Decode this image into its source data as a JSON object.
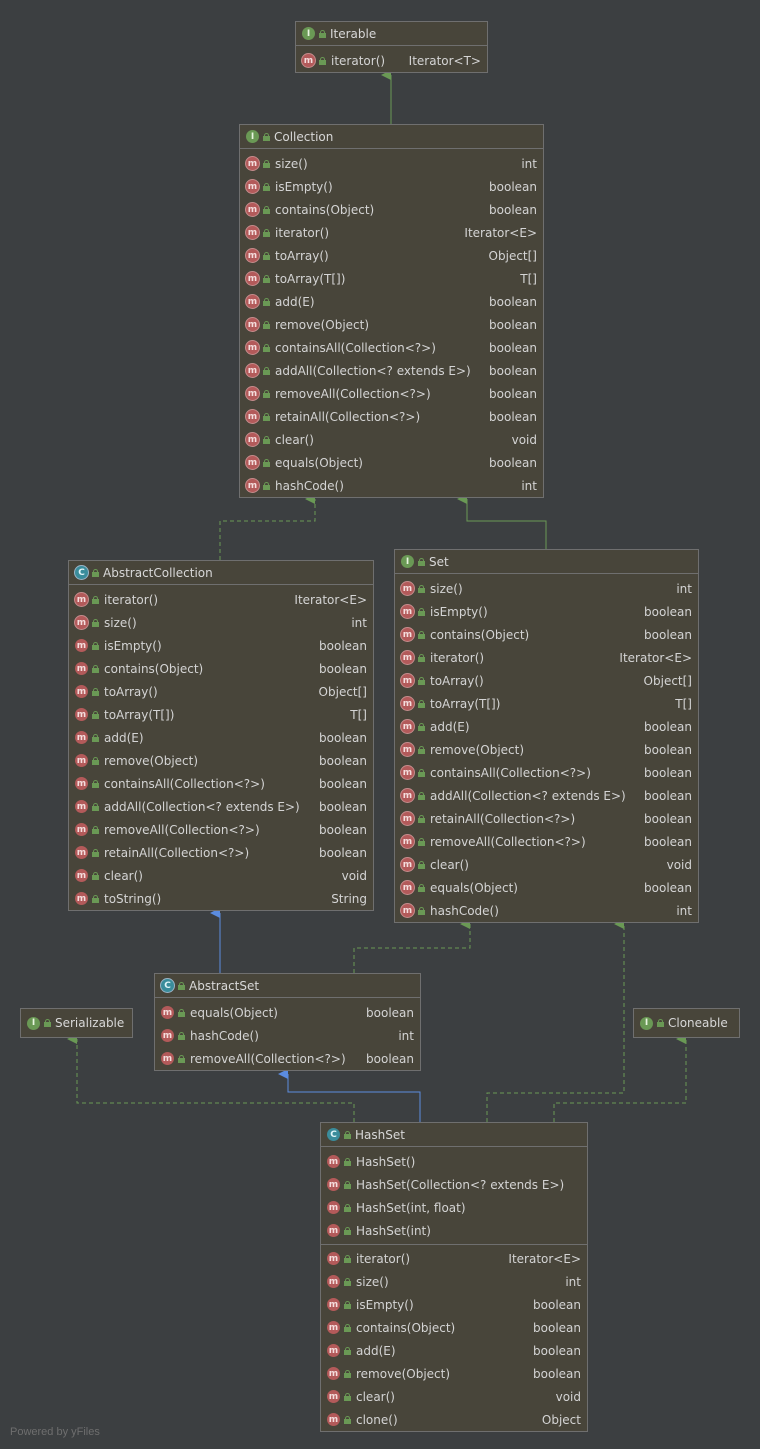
{
  "nodes": {
    "iterable": {
      "kind": "I",
      "title": "Iterable",
      "members": [
        {
          "k": "ma",
          "name": "iterator()",
          "type": "Iterator<T>"
        }
      ]
    },
    "collection": {
      "kind": "I",
      "title": "Collection",
      "members": [
        {
          "k": "ma",
          "name": "size()",
          "type": "int"
        },
        {
          "k": "ma",
          "name": "isEmpty()",
          "type": "boolean"
        },
        {
          "k": "ma",
          "name": "contains(Object)",
          "type": "boolean"
        },
        {
          "k": "ma",
          "name": "iterator()",
          "type": "Iterator<E>"
        },
        {
          "k": "ma",
          "name": "toArray()",
          "type": "Object[]"
        },
        {
          "k": "ma",
          "name": "toArray(T[])",
          "type": "T[]"
        },
        {
          "k": "ma",
          "name": "add(E)",
          "type": "boolean"
        },
        {
          "k": "ma",
          "name": "remove(Object)",
          "type": "boolean"
        },
        {
          "k": "ma",
          "name": "containsAll(Collection<?>)",
          "type": "boolean"
        },
        {
          "k": "ma",
          "name": "addAll(Collection<? extends E>)",
          "type": "boolean"
        },
        {
          "k": "ma",
          "name": "removeAll(Collection<?>)",
          "type": "boolean"
        },
        {
          "k": "ma",
          "name": "retainAll(Collection<?>)",
          "type": "boolean"
        },
        {
          "k": "ma",
          "name": "clear()",
          "type": "void"
        },
        {
          "k": "ma",
          "name": "equals(Object)",
          "type": "boolean"
        },
        {
          "k": "ma",
          "name": "hashCode()",
          "type": "int"
        }
      ]
    },
    "abstractCollection": {
      "kind": "AC",
      "title": "AbstractCollection",
      "members": [
        {
          "k": "ma",
          "name": "iterator()",
          "type": "Iterator<E>"
        },
        {
          "k": "ma",
          "name": "size()",
          "type": "int"
        },
        {
          "k": "m",
          "name": "isEmpty()",
          "type": "boolean"
        },
        {
          "k": "m",
          "name": "contains(Object)",
          "type": "boolean"
        },
        {
          "k": "m",
          "name": "toArray()",
          "type": "Object[]"
        },
        {
          "k": "m",
          "name": "toArray(T[])",
          "type": "T[]"
        },
        {
          "k": "m",
          "name": "add(E)",
          "type": "boolean"
        },
        {
          "k": "m",
          "name": "remove(Object)",
          "type": "boolean"
        },
        {
          "k": "m",
          "name": "containsAll(Collection<?>)",
          "type": "boolean"
        },
        {
          "k": "m",
          "name": "addAll(Collection<? extends E>)",
          "type": "boolean"
        },
        {
          "k": "m",
          "name": "removeAll(Collection<?>)",
          "type": "boolean"
        },
        {
          "k": "m",
          "name": "retainAll(Collection<?>)",
          "type": "boolean"
        },
        {
          "k": "m",
          "name": "clear()",
          "type": "void"
        },
        {
          "k": "m",
          "name": "toString()",
          "type": "String"
        }
      ]
    },
    "set": {
      "kind": "I",
      "title": "Set",
      "members": [
        {
          "k": "ma",
          "name": "size()",
          "type": "int"
        },
        {
          "k": "ma",
          "name": "isEmpty()",
          "type": "boolean"
        },
        {
          "k": "ma",
          "name": "contains(Object)",
          "type": "boolean"
        },
        {
          "k": "ma",
          "name": "iterator()",
          "type": "Iterator<E>"
        },
        {
          "k": "ma",
          "name": "toArray()",
          "type": "Object[]"
        },
        {
          "k": "ma",
          "name": "toArray(T[])",
          "type": "T[]"
        },
        {
          "k": "ma",
          "name": "add(E)",
          "type": "boolean"
        },
        {
          "k": "ma",
          "name": "remove(Object)",
          "type": "boolean"
        },
        {
          "k": "ma",
          "name": "containsAll(Collection<?>)",
          "type": "boolean"
        },
        {
          "k": "ma",
          "name": "addAll(Collection<? extends E>)",
          "type": "boolean"
        },
        {
          "k": "ma",
          "name": "retainAll(Collection<?>)",
          "type": "boolean"
        },
        {
          "k": "ma",
          "name": "removeAll(Collection<?>)",
          "type": "boolean"
        },
        {
          "k": "ma",
          "name": "clear()",
          "type": "void"
        },
        {
          "k": "ma",
          "name": "equals(Object)",
          "type": "boolean"
        },
        {
          "k": "ma",
          "name": "hashCode()",
          "type": "int"
        }
      ]
    },
    "abstractSet": {
      "kind": "AC",
      "title": "AbstractSet",
      "members": [
        {
          "k": "m",
          "name": "equals(Object)",
          "type": "boolean"
        },
        {
          "k": "m",
          "name": "hashCode()",
          "type": "int"
        },
        {
          "k": "m",
          "name": "removeAll(Collection<?>)",
          "type": "boolean"
        }
      ]
    },
    "serializable": {
      "kind": "I",
      "title": "Serializable",
      "members": []
    },
    "cloneable": {
      "kind": "I",
      "title": "Cloneable",
      "members": []
    },
    "hashSet": {
      "kind": "C",
      "title": "HashSet",
      "ctors": [
        {
          "k": "m",
          "name": "HashSet()",
          "type": ""
        },
        {
          "k": "m",
          "name": "HashSet(Collection<? extends E>)",
          "type": ""
        },
        {
          "k": "m",
          "name": "HashSet(int, float)",
          "type": ""
        },
        {
          "k": "m",
          "name": "HashSet(int)",
          "type": ""
        }
      ],
      "members": [
        {
          "k": "m",
          "name": "iterator()",
          "type": "Iterator<E>"
        },
        {
          "k": "m",
          "name": "size()",
          "type": "int"
        },
        {
          "k": "m",
          "name": "isEmpty()",
          "type": "boolean"
        },
        {
          "k": "m",
          "name": "contains(Object)",
          "type": "boolean"
        },
        {
          "k": "m",
          "name": "add(E)",
          "type": "boolean"
        },
        {
          "k": "m",
          "name": "remove(Object)",
          "type": "boolean"
        },
        {
          "k": "m",
          "name": "clear()",
          "type": "void"
        },
        {
          "k": "m",
          "name": "clone()",
          "type": "Object"
        }
      ]
    }
  },
  "kind_glyphs": {
    "I": "I",
    "C": "C",
    "AC": "C",
    "m": "m",
    "ma": "m"
  },
  "colors": {
    "background": "#3c3f41",
    "node": "#48453a",
    "implements": "#6a9955",
    "extends": "#5b8ce0"
  },
  "footer": "Powered by yFiles"
}
